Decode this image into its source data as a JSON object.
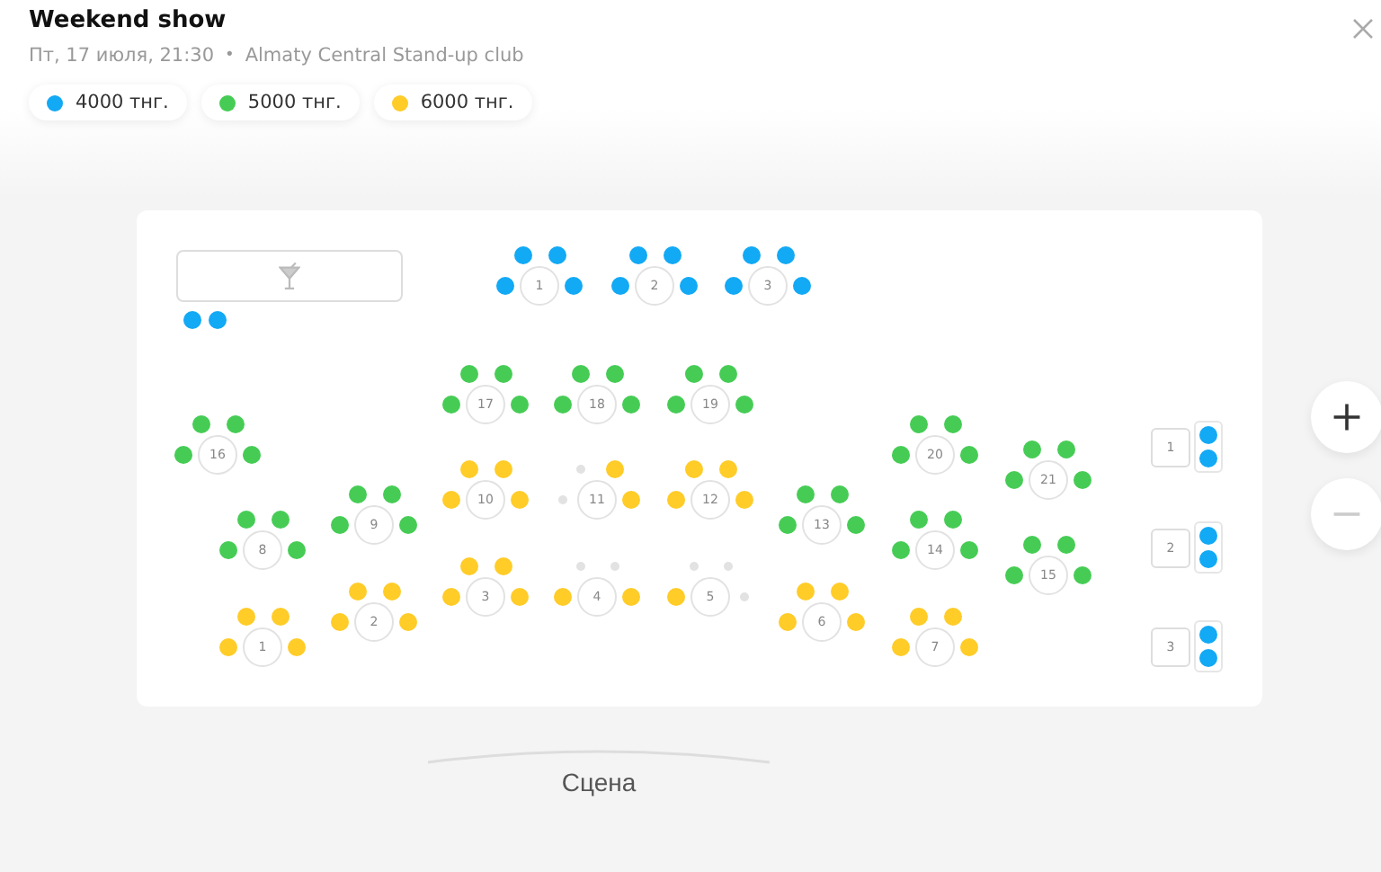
{
  "header": {
    "title": "Weekend show",
    "date": "Пт, 17 июля, 21:30",
    "separator": "•",
    "venue": "Almaty Central Stand-up club"
  },
  "categories": [
    {
      "price": "4000 тнг.",
      "color": "#12a9f5"
    },
    {
      "price": "5000 тнг.",
      "color": "#46cc55"
    },
    {
      "price": "6000 тнг.",
      "color": "#ffcc28"
    }
  ],
  "bar": {
    "seats": [
      {
        "available": true,
        "color": "#12a9f5"
      },
      {
        "available": true,
        "color": "#12a9f5"
      }
    ]
  },
  "tables": [
    {
      "label": "1",
      "seats": [
        {
          "available": true,
          "color": "#12a9f5"
        },
        {
          "available": true,
          "color": "#12a9f5"
        },
        {
          "available": true,
          "color": "#12a9f5"
        },
        {
          "available": true,
          "color": "#12a9f5"
        }
      ]
    },
    {
      "label": "2",
      "seats": [
        {
          "available": true,
          "color": "#12a9f5"
        },
        {
          "available": true,
          "color": "#12a9f5"
        },
        {
          "available": true,
          "color": "#12a9f5"
        },
        {
          "available": true,
          "color": "#12a9f5"
        }
      ]
    },
    {
      "label": "3",
      "seats": [
        {
          "available": true,
          "color": "#12a9f5"
        },
        {
          "available": true,
          "color": "#12a9f5"
        },
        {
          "available": true,
          "color": "#12a9f5"
        },
        {
          "available": true,
          "color": "#12a9f5"
        }
      ]
    },
    {
      "label": "17",
      "seats": [
        {
          "available": true,
          "color": "#46cc55"
        },
        {
          "available": true,
          "color": "#46cc55"
        },
        {
          "available": true,
          "color": "#46cc55"
        },
        {
          "available": true,
          "color": "#46cc55"
        }
      ]
    },
    {
      "label": "18",
      "seats": [
        {
          "available": true,
          "color": "#46cc55"
        },
        {
          "available": true,
          "color": "#46cc55"
        },
        {
          "available": true,
          "color": "#46cc55"
        },
        {
          "available": true,
          "color": "#46cc55"
        }
      ]
    },
    {
      "label": "19",
      "seats": [
        {
          "available": true,
          "color": "#46cc55"
        },
        {
          "available": true,
          "color": "#46cc55"
        },
        {
          "available": true,
          "color": "#46cc55"
        },
        {
          "available": true,
          "color": "#46cc55"
        }
      ]
    },
    {
      "label": "16",
      "seats": [
        {
          "available": true,
          "color": "#46cc55"
        },
        {
          "available": true,
          "color": "#46cc55"
        },
        {
          "available": true,
          "color": "#46cc55"
        },
        {
          "available": true,
          "color": "#46cc55"
        }
      ]
    },
    {
      "label": "20",
      "seats": [
        {
          "available": true,
          "color": "#46cc55"
        },
        {
          "available": true,
          "color": "#46cc55"
        },
        {
          "available": true,
          "color": "#46cc55"
        },
        {
          "available": true,
          "color": "#46cc55"
        }
      ]
    },
    {
      "label": "21",
      "seats": [
        {
          "available": true,
          "color": "#46cc55"
        },
        {
          "available": true,
          "color": "#46cc55"
        },
        {
          "available": true,
          "color": "#46cc55"
        },
        {
          "available": true,
          "color": "#46cc55"
        }
      ]
    },
    {
      "label": "10",
      "seats": [
        {
          "available": true,
          "color": "#ffcc28"
        },
        {
          "available": true,
          "color": "#ffcc28"
        },
        {
          "available": true,
          "color": "#ffcc28"
        },
        {
          "available": true,
          "color": "#ffcc28"
        }
      ]
    },
    {
      "label": "11",
      "seats": [
        {
          "available": false
        },
        {
          "available": true,
          "color": "#ffcc28"
        },
        {
          "available": false
        },
        {
          "available": true,
          "color": "#ffcc28"
        }
      ]
    },
    {
      "label": "12",
      "seats": [
        {
          "available": true,
          "color": "#ffcc28"
        },
        {
          "available": true,
          "color": "#ffcc28"
        },
        {
          "available": true,
          "color": "#ffcc28"
        },
        {
          "available": true,
          "color": "#ffcc28"
        }
      ]
    },
    {
      "label": "9",
      "seats": [
        {
          "available": true,
          "color": "#46cc55"
        },
        {
          "available": true,
          "color": "#46cc55"
        },
        {
          "available": true,
          "color": "#46cc55"
        },
        {
          "available": true,
          "color": "#46cc55"
        }
      ]
    },
    {
      "label": "8",
      "seats": [
        {
          "available": true,
          "color": "#46cc55"
        },
        {
          "available": true,
          "color": "#46cc55"
        },
        {
          "available": true,
          "color": "#46cc55"
        },
        {
          "available": true,
          "color": "#46cc55"
        }
      ]
    },
    {
      "label": "13",
      "seats": [
        {
          "available": true,
          "color": "#46cc55"
        },
        {
          "available": true,
          "color": "#46cc55"
        },
        {
          "available": true,
          "color": "#46cc55"
        },
        {
          "available": true,
          "color": "#46cc55"
        }
      ]
    },
    {
      "label": "14",
      "seats": [
        {
          "available": true,
          "color": "#46cc55"
        },
        {
          "available": true,
          "color": "#46cc55"
        },
        {
          "available": true,
          "color": "#46cc55"
        },
        {
          "available": true,
          "color": "#46cc55"
        }
      ]
    },
    {
      "label": "15",
      "seats": [
        {
          "available": true,
          "color": "#46cc55"
        },
        {
          "available": true,
          "color": "#46cc55"
        },
        {
          "available": true,
          "color": "#46cc55"
        },
        {
          "available": true,
          "color": "#46cc55"
        }
      ]
    },
    {
      "label": "3",
      "seats": [
        {
          "available": true,
          "color": "#ffcc28"
        },
        {
          "available": true,
          "color": "#ffcc28"
        },
        {
          "available": true,
          "color": "#ffcc28"
        },
        {
          "available": true,
          "color": "#ffcc28"
        }
      ]
    },
    {
      "label": "4",
      "seats": [
        {
          "available": false
        },
        {
          "available": false
        },
        {
          "available": true,
          "color": "#ffcc28"
        },
        {
          "available": true,
          "color": "#ffcc28"
        }
      ]
    },
    {
      "label": "5",
      "seats": [
        {
          "available": false
        },
        {
          "available": false
        },
        {
          "available": true,
          "color": "#ffcc28"
        },
        {
          "available": false
        }
      ]
    },
    {
      "label": "2",
      "seats": [
        {
          "available": true,
          "color": "#ffcc28"
        },
        {
          "available": true,
          "color": "#ffcc28"
        },
        {
          "available": true,
          "color": "#ffcc28"
        },
        {
          "available": true,
          "color": "#ffcc28"
        }
      ]
    },
    {
      "label": "1",
      "seats": [
        {
          "available": true,
          "color": "#ffcc28"
        },
        {
          "available": true,
          "color": "#ffcc28"
        },
        {
          "available": true,
          "color": "#ffcc28"
        },
        {
          "available": true,
          "color": "#ffcc28"
        }
      ]
    },
    {
      "label": "6",
      "seats": [
        {
          "available": true,
          "color": "#ffcc28"
        },
        {
          "available": true,
          "color": "#ffcc28"
        },
        {
          "available": true,
          "color": "#ffcc28"
        },
        {
          "available": true,
          "color": "#ffcc28"
        }
      ]
    },
    {
      "label": "7",
      "seats": [
        {
          "available": true,
          "color": "#ffcc28"
        },
        {
          "available": true,
          "color": "#ffcc28"
        },
        {
          "available": true,
          "color": "#ffcc28"
        },
        {
          "available": true,
          "color": "#ffcc28"
        }
      ]
    }
  ],
  "booths": [
    {
      "label": "1",
      "seats": [
        {
          "available": true,
          "color": "#12a9f5"
        },
        {
          "available": true,
          "color": "#12a9f5"
        }
      ]
    },
    {
      "label": "2",
      "seats": [
        {
          "available": true,
          "color": "#12a9f5"
        },
        {
          "available": true,
          "color": "#12a9f5"
        }
      ]
    },
    {
      "label": "3",
      "seats": [
        {
          "available": true,
          "color": "#12a9f5"
        },
        {
          "available": true,
          "color": "#12a9f5"
        }
      ]
    }
  ],
  "stage": {
    "label": "Сцена"
  },
  "zoom_controls": [
    {
      "kind": "in",
      "disabled": false
    },
    {
      "kind": "out",
      "disabled": true
    }
  ]
}
